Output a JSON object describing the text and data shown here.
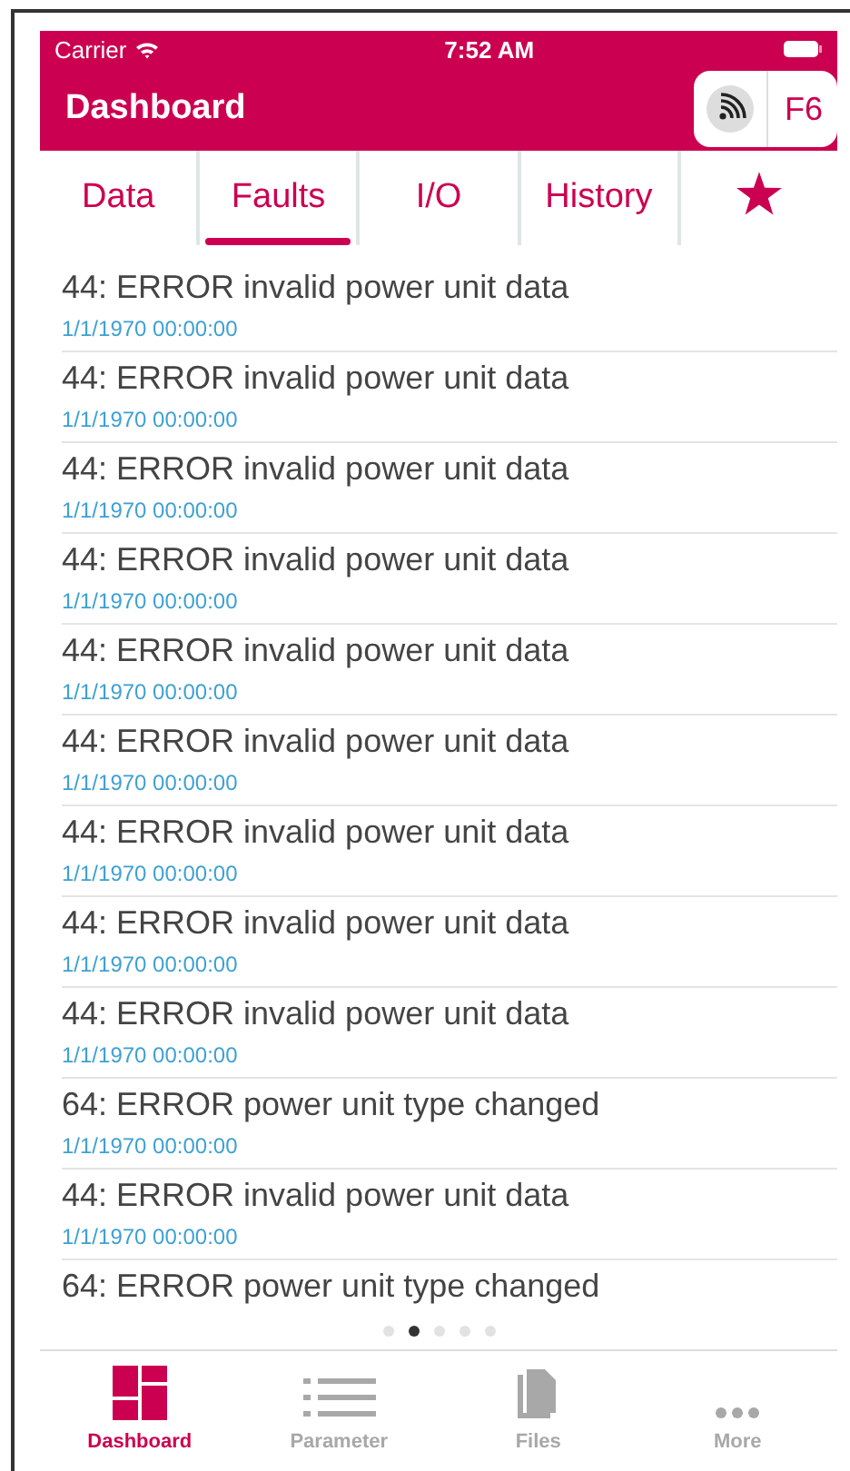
{
  "status_bar": {
    "carrier": "Carrier",
    "time": "7:52 AM"
  },
  "nav_bar": {
    "title": "Dashboard",
    "badge": "F6"
  },
  "tabs": [
    {
      "kind": "text",
      "label": "Data",
      "selected": false
    },
    {
      "kind": "text",
      "label": "Faults",
      "selected": true
    },
    {
      "kind": "text",
      "label": "I/O",
      "selected": false
    },
    {
      "kind": "text",
      "label": "History",
      "selected": false
    },
    {
      "kind": "star",
      "selected": false
    }
  ],
  "faults": [
    {
      "message": "44: ERROR invalid power unit data",
      "date": "1/1/1970 00:00:00"
    },
    {
      "message": "44: ERROR invalid power unit data",
      "date": "1/1/1970 00:00:00"
    },
    {
      "message": "44: ERROR invalid power unit data",
      "date": "1/1/1970 00:00:00"
    },
    {
      "message": "44: ERROR invalid power unit data",
      "date": "1/1/1970 00:00:00"
    },
    {
      "message": "44: ERROR invalid power unit data",
      "date": "1/1/1970 00:00:00"
    },
    {
      "message": "44: ERROR invalid power unit data",
      "date": "1/1/1970 00:00:00"
    },
    {
      "message": "44: ERROR invalid power unit data",
      "date": "1/1/1970 00:00:00"
    },
    {
      "message": "44: ERROR invalid power unit data",
      "date": "1/1/1970 00:00:00"
    },
    {
      "message": "44: ERROR invalid power unit data",
      "date": "1/1/1970 00:00:00"
    },
    {
      "message": "64: ERROR power unit type changed",
      "date": "1/1/1970 00:00:00"
    },
    {
      "message": "44: ERROR invalid power unit data",
      "date": "1/1/1970 00:00:00"
    },
    {
      "message": "64: ERROR power unit type changed"
    }
  ],
  "page_dots": [
    {
      "selected": false
    },
    {
      "selected": true
    },
    {
      "selected": false
    },
    {
      "selected": false
    },
    {
      "selected": false
    }
  ],
  "tab_bar": [
    {
      "kind": "dashboard",
      "label": "Dashboard",
      "selected": true
    },
    {
      "kind": "list",
      "label": "Parameter",
      "selected": false
    },
    {
      "kind": "files",
      "label": "Files",
      "selected": false
    },
    {
      "kind": "more",
      "label": "More",
      "selected": false
    }
  ]
}
